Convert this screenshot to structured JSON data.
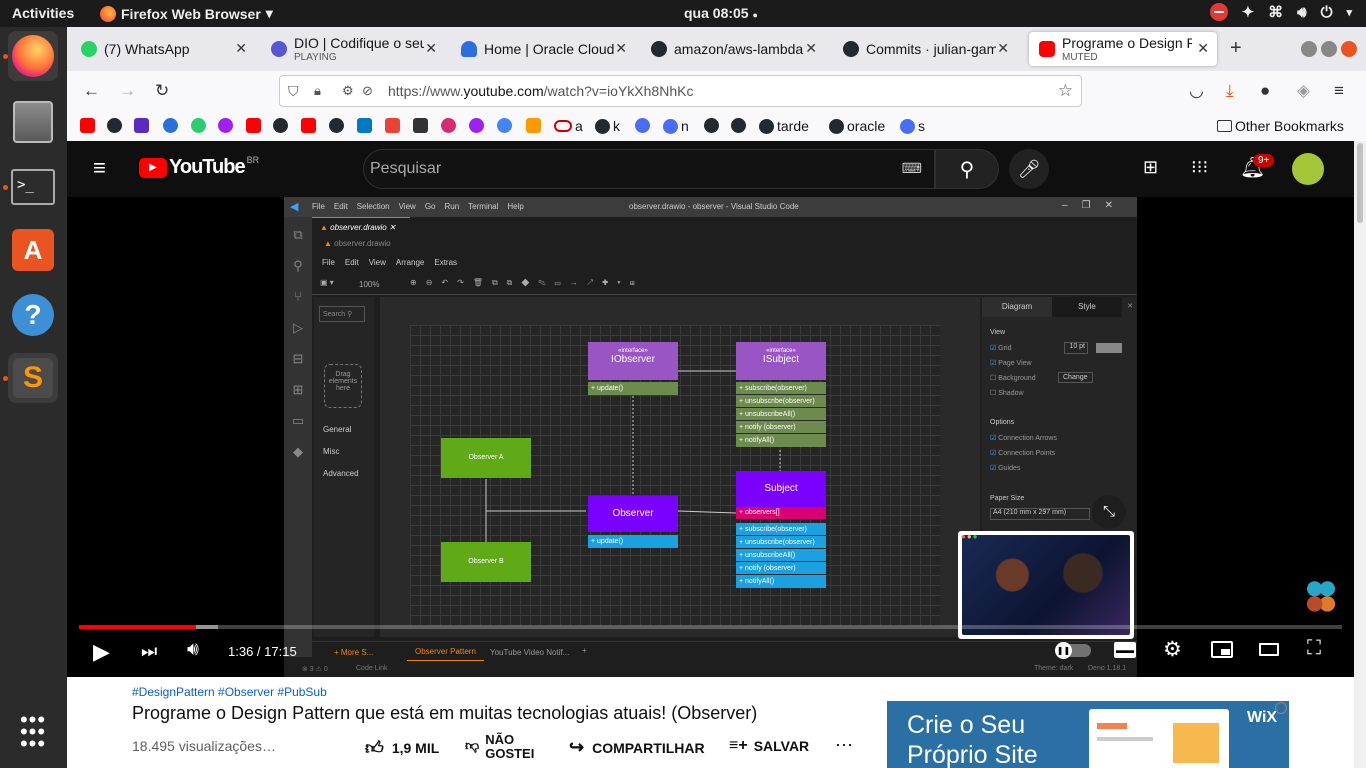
{
  "system": {
    "activities": "Activities",
    "app_name": "Firefox Web Browser",
    "clock": "qua 08:05"
  },
  "tabs": [
    {
      "title": "(7) WhatsApp",
      "subtitle": "",
      "color": "#25d366"
    },
    {
      "title": "DIO | Codifique o seu",
      "subtitle": "PLAYING",
      "color": "#5856d6"
    },
    {
      "title": "Home | Oracle Cloud",
      "subtitle": "",
      "color": "#2a6fdb"
    },
    {
      "title": "amazon/aws-lambda",
      "subtitle": "",
      "color": "#24292f"
    },
    {
      "title": "Commits · julian-gam",
      "subtitle": "",
      "color": "#24292f"
    },
    {
      "title": "Programe o Design P",
      "subtitle": "MUTED",
      "color": "#ff0000"
    }
  ],
  "url": {
    "prefix": "https://www.",
    "domain": "youtube.com",
    "path": "/watch?v=ioYkXh8NhKc"
  },
  "bookmarks": {
    "items": [
      "a",
      "k",
      "n",
      "tarde",
      "oracle",
      "s"
    ],
    "other": "Other Bookmarks"
  },
  "youtube": {
    "logo": "YouTube",
    "region": "BR",
    "search_placeholder": "Pesquisar",
    "notifications": "9+",
    "time": "1:36 / 17:15",
    "progress": 0.093,
    "hashtags": "#DesignPattern #Observer #PubSub",
    "title": "Programe o Design Pattern que está em muitas tecnologias atuais! (Observer)",
    "views": "18.495 visualizações…",
    "likes": "1,9 MIL",
    "dislike": "NÃO GOSTEI",
    "share": "COMPARTILHAR",
    "save": "SALVAR",
    "ad_line1": "Crie o Seu",
    "ad_line2": "Próprio Site",
    "ad_brand": "WiX"
  },
  "vscode": {
    "title": "observer.drawio - observer - Visual Studio Code",
    "menu": [
      "File",
      "Edit",
      "Selection",
      "View",
      "Go",
      "Run",
      "Terminal",
      "Help"
    ],
    "tab": "observer.drawio",
    "breadcrumb": "observer.drawio",
    "drawio_menu": [
      "File",
      "Edit",
      "View",
      "Arrange",
      "Extras"
    ],
    "zoom": "100%",
    "sidebar": [
      "General",
      "Misc",
      "Advanced"
    ],
    "drag_hint": "Drag elements here",
    "panel_tabs": [
      "Diagram",
      "Style"
    ],
    "view_label": "View",
    "grid": "Grid",
    "grid_size": "10 pt",
    "page_view": "Page View",
    "background": "Background",
    "change": "Change",
    "shadow": "Shadow",
    "options": "Options",
    "connection_arrows": "Connection Arrows",
    "connection_points": "Connection Points",
    "guides": "Guides",
    "paper_size": "Paper Size",
    "paper_value": "A4 (210 mm x 297 mm)",
    "bottom_tabs": [
      "Observer Pattern",
      "YouTube Video Notif..."
    ],
    "more": "+ More S...",
    "status_left": "⊗ 3 ⚠ 0",
    "code_link": "Code Link",
    "theme": "Theme: dark",
    "deno": "Deno 1.18.1",
    "diagram": {
      "iobserver_stereo": "«interface»",
      "iobserver": "IObserver",
      "iobserver_update": "+ update()",
      "isubject_stereo": "«interface»",
      "isubject": "ISubject",
      "isubject_methods": [
        "+ subscribe(observer)",
        "+ unsubscribe(observer)",
        "+ unsubscribeAll()",
        "+ notify (observer)",
        "+ notifyAll()"
      ],
      "observer_a": "Observer A",
      "observer_b": "Observer B",
      "observer": "Observer",
      "observer_update": "+ update()",
      "subject": "Subject",
      "subject_field": "+ observers[]",
      "subject_methods": [
        "+ subscribe(observer)",
        "+ unsubscribe(observer)",
        "+ unsubscribeAll()",
        "+ notify (observer)",
        "+ notifyAll()"
      ]
    }
  }
}
